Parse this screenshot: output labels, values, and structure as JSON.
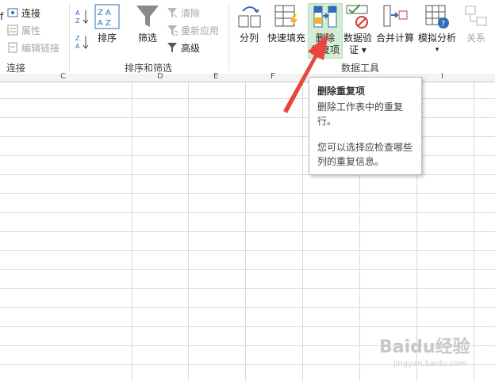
{
  "connections": {
    "items": [
      "连接",
      "属性",
      "编辑链接"
    ],
    "group_label": "连接",
    "partial_left": "f"
  },
  "sort_filter": {
    "sort_label": "排序",
    "filter_label": "筛选",
    "clear_label": "清除",
    "reapply_label": "重新应用",
    "advanced_label": "高级",
    "group_label": "排序和筛选"
  },
  "data_tools": {
    "split_label": "分列",
    "flash_fill_label": "快速填充",
    "remove_dup_line1": "删除",
    "remove_dup_line2": "重复项",
    "validation_line1": "数据验",
    "validation_line2": "证",
    "consolidate_label": "合并计算",
    "whatif_label": "模拟分析",
    "relations_label": "关系",
    "group_label": "数据工具"
  },
  "columns": [
    "C",
    "D",
    "E",
    "F",
    "I"
  ],
  "tooltip": {
    "title": "删除重复项",
    "line1": "删除工作表中的重复",
    "line2": "行。",
    "line3": "您可以选择应检查哪些",
    "line4": "列的重复信息。"
  },
  "watermark": {
    "text": "Baidu经验",
    "sub": "jingyan.baidu.com"
  },
  "colors": {
    "highlight": "#d3ecd3",
    "arrow": "#e8453c",
    "accent_blue": "#2f6db5"
  }
}
